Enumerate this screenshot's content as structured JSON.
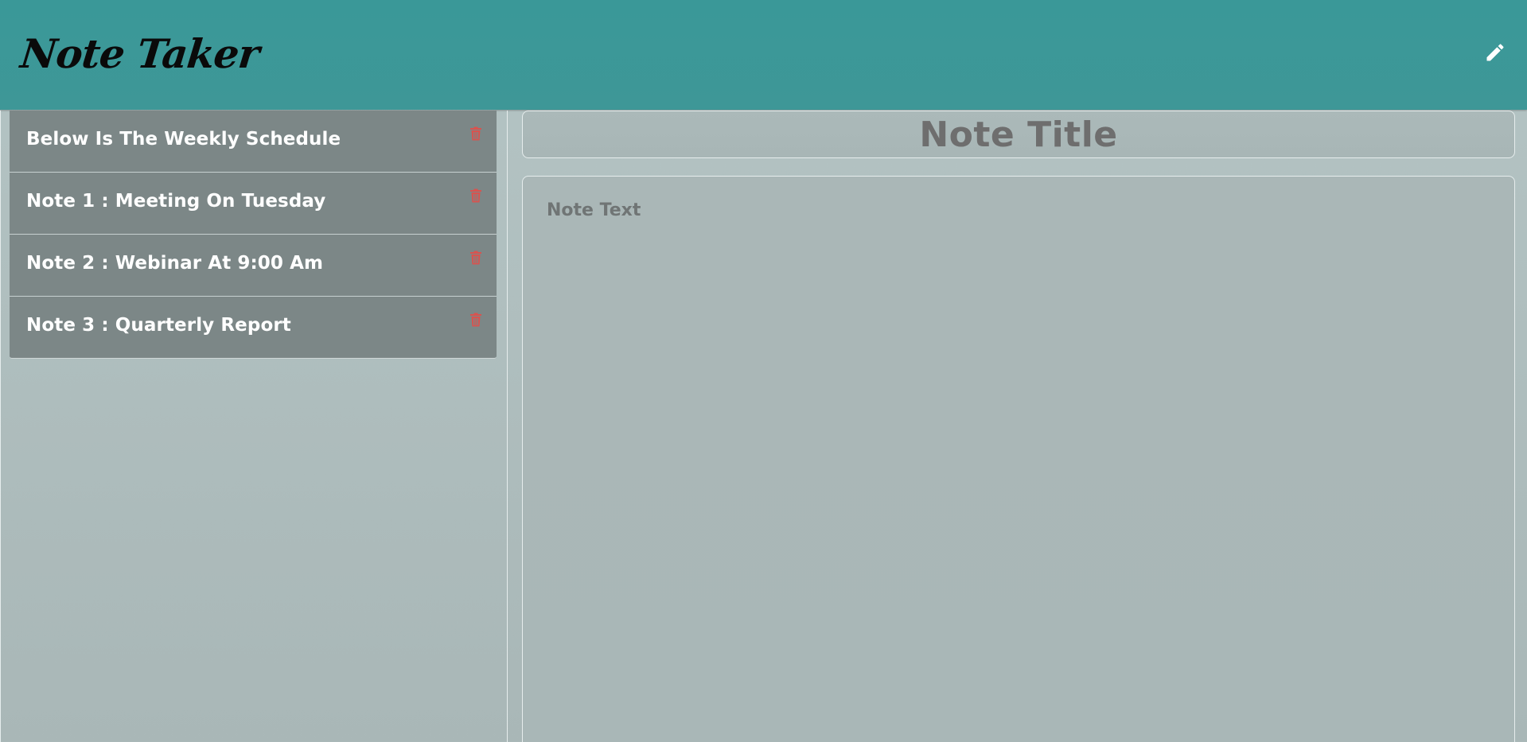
{
  "app": {
    "title": "Note Taker"
  },
  "navbar": {
    "new_note_icon": "pencil-icon"
  },
  "notes": [
    {
      "title": "Below Is The Weekly Schedule",
      "delete_icon": "trash-icon"
    },
    {
      "title": "Note 1 : Meeting On Tuesday",
      "delete_icon": "trash-icon"
    },
    {
      "title": "Note 2 : Webinar At 9:00 Am",
      "delete_icon": "trash-icon"
    },
    {
      "title": "Note 3 : Quarterly Report",
      "delete_icon": "trash-icon"
    }
  ],
  "editor": {
    "title_placeholder": "Note Title",
    "text_placeholder": "Note Text"
  },
  "colors": {
    "navbar": "#3a9898",
    "background": "#a9b7b7",
    "note_item": "#7c8787",
    "delete": "#d9534f",
    "placeholder": "#6e6e6e"
  }
}
